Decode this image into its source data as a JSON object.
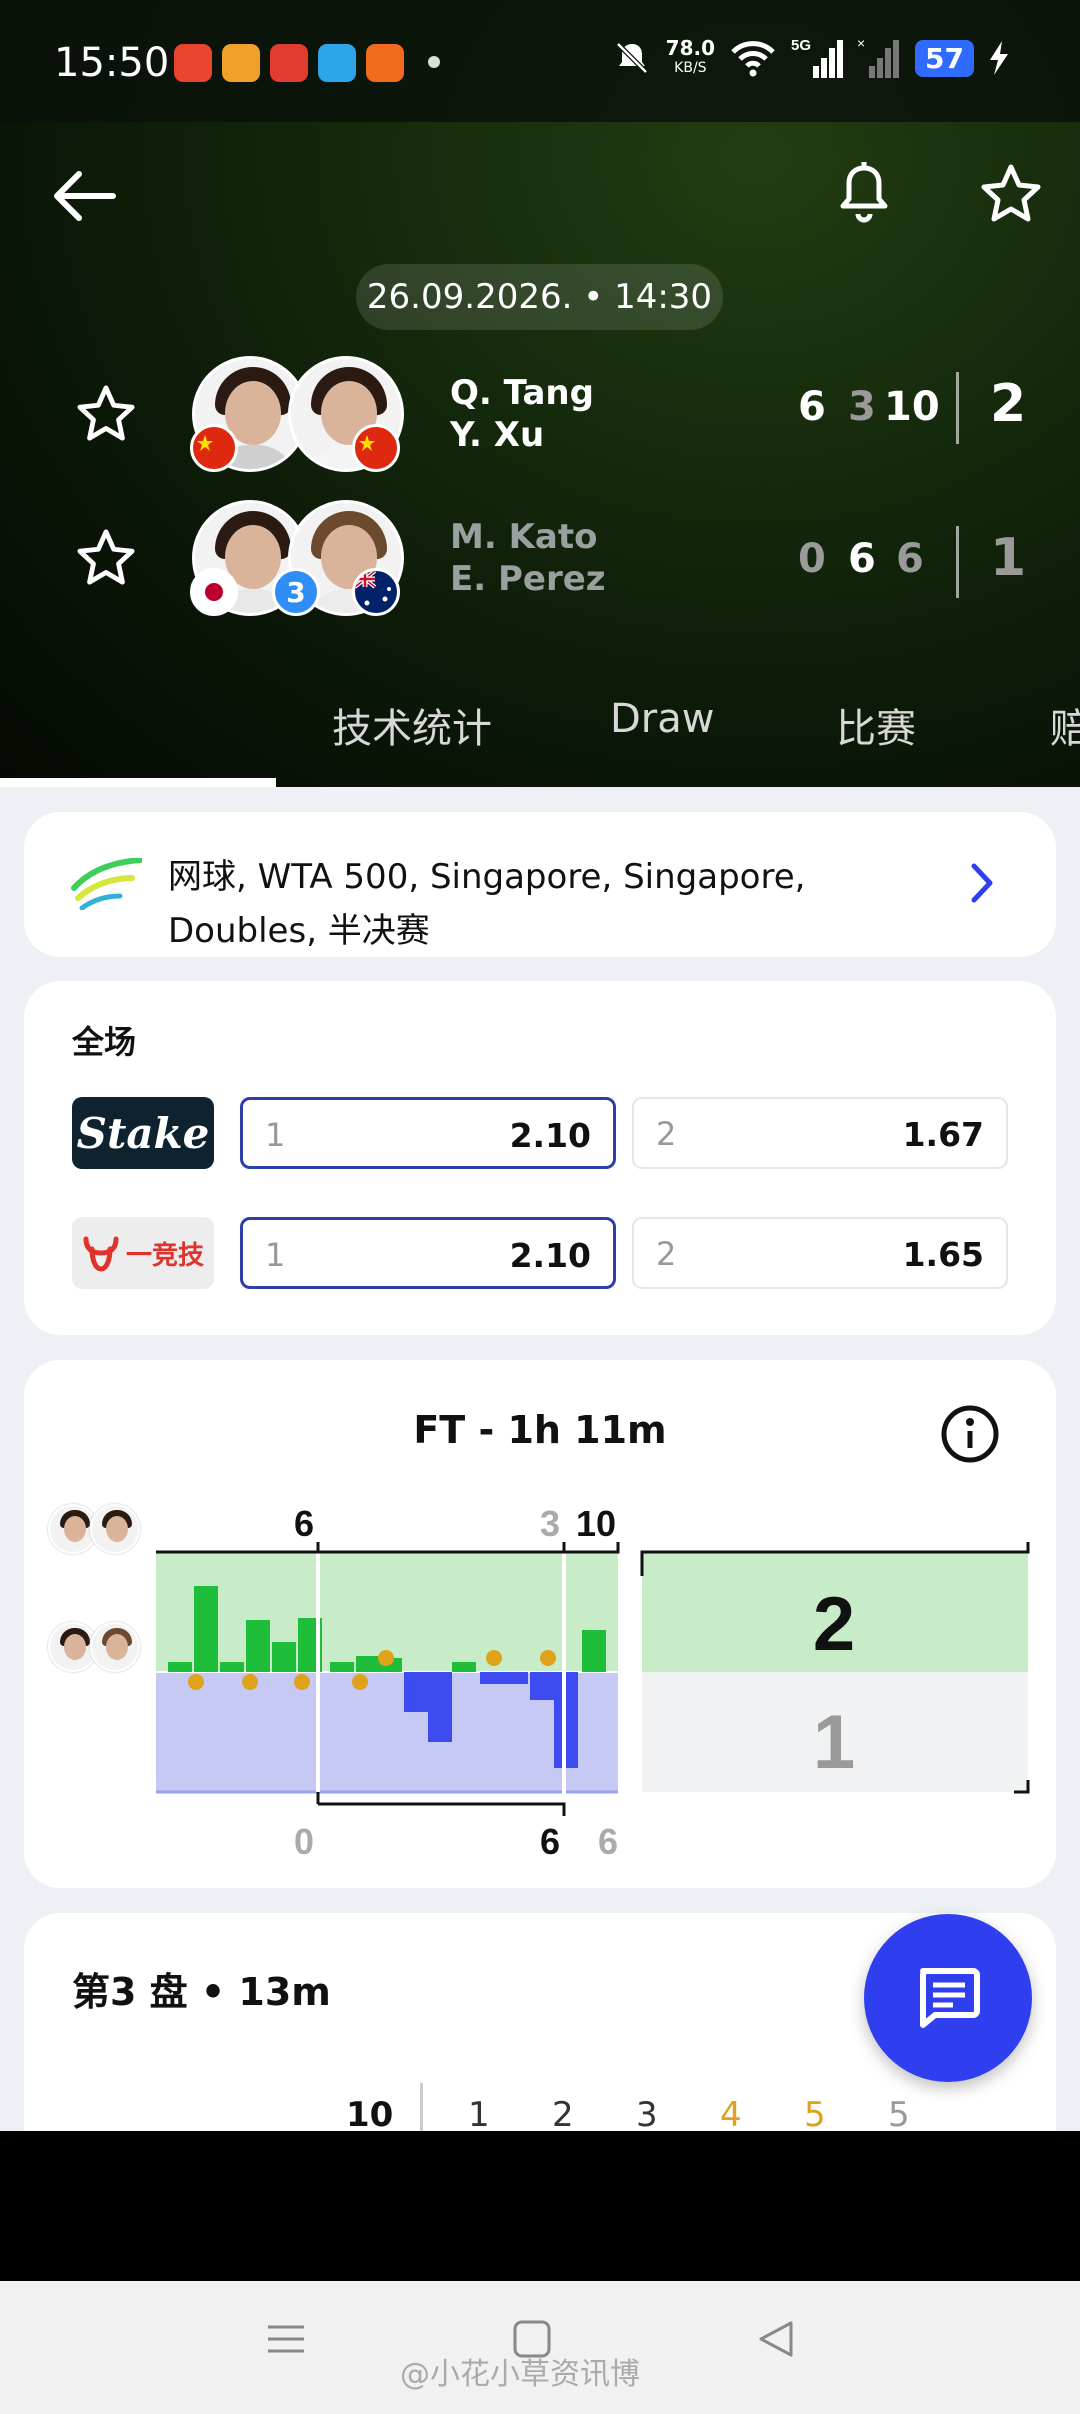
{
  "status_bar": {
    "time": "15:50",
    "net_speed": "78.0",
    "net_unit": "KB/S",
    "network": "5G",
    "battery": "57",
    "app_icon_colors": [
      "#e8452c",
      "#f0a12a",
      "#e23b30",
      "#2ea5ea",
      "#f26b1d"
    ]
  },
  "match": {
    "date_time": "26.09.2026. • 14:30",
    "team1": {
      "player1": "Q. Tang",
      "player2": "Y. Xu",
      "sets": [
        "6",
        "3",
        "10"
      ],
      "total": "2"
    },
    "team2": {
      "player1": "M. Kato",
      "player2": "E. Perez",
      "seed": "3",
      "sets": [
        "0",
        "6",
        "6"
      ],
      "total": "1"
    }
  },
  "tabs": [
    "技术统计",
    "Draw",
    "比赛",
    "赔"
  ],
  "tournament": {
    "text": "网球, WTA 500, Singapore, Singapore, Doubles, 半决赛"
  },
  "odds": {
    "title": "全场",
    "books": [
      {
        "name": "Stake",
        "o1_label": "1",
        "o1": "2.10",
        "o2_label": "2",
        "o2": "1.67"
      },
      {
        "name": "一竞技",
        "o1_label": "1",
        "o1": "2.10",
        "o2_label": "2",
        "o2": "1.65"
      }
    ]
  },
  "momentum": {
    "title": "FT - 1h 11m",
    "top_set_scores": [
      "6",
      "3",
      "10"
    ],
    "bottom_set_scores": [
      "0",
      "6",
      "6"
    ],
    "total_top": "2",
    "total_bottom": "1"
  },
  "set3": {
    "title": "第3 盘 • 13m",
    "score": "10",
    "games": [
      "1",
      "2",
      "3",
      "4",
      "5",
      "5"
    ]
  },
  "watermark": "@小花小草资讯博",
  "colors": {
    "accent": "#2f3ff0",
    "win_green": "#1fbe3a",
    "loss_blue": "#3d4bf0",
    "highlight": "#e0a21a"
  }
}
